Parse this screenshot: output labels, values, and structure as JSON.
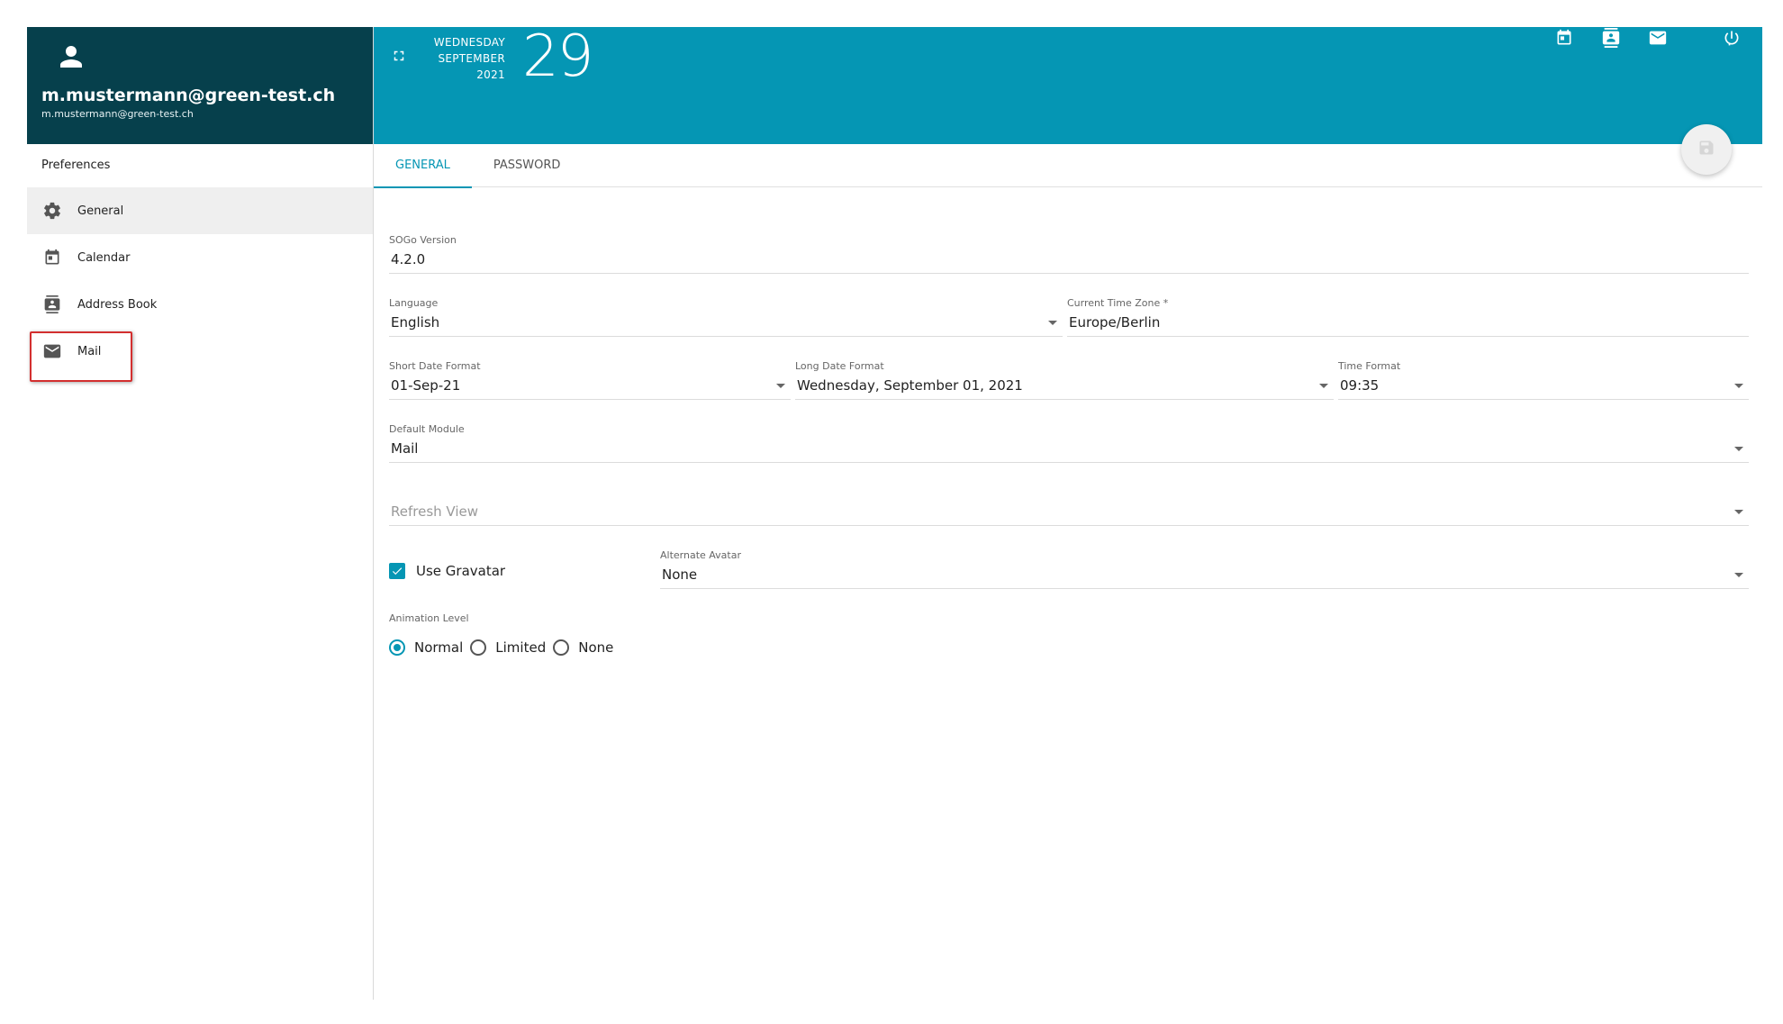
{
  "user": {
    "name": "m.mustermann@green-test.ch",
    "email": "m.mustermann@green-test.ch"
  },
  "sidebar": {
    "section_title": "Preferences",
    "items": [
      {
        "label": "General",
        "icon": "gear-icon"
      },
      {
        "label": "Calendar",
        "icon": "calendar-icon"
      },
      {
        "label": "Address Book",
        "icon": "contacts-icon"
      },
      {
        "label": "Mail",
        "icon": "mail-icon"
      }
    ]
  },
  "topbar": {
    "weekday": "WEDNESDAY",
    "month": "SEPTEMBER",
    "year": "2021",
    "day": "29",
    "icons": [
      "calendar-icon",
      "contacts-icon",
      "mail-icon",
      "power-icon"
    ]
  },
  "tabs": [
    {
      "label": "GENERAL"
    },
    {
      "label": "PASSWORD"
    }
  ],
  "form": {
    "sogo_version": {
      "label": "SOGo Version",
      "value": "4.2.0"
    },
    "language": {
      "label": "Language",
      "value": "English"
    },
    "timezone": {
      "label": "Current Time Zone *",
      "value": "Europe/Berlin"
    },
    "short_date": {
      "label": "Short Date Format",
      "value": "01-Sep-21"
    },
    "long_date": {
      "label": "Long Date Format",
      "value": "Wednesday, September 01, 2021"
    },
    "time_format": {
      "label": "Time Format",
      "value": "09:35"
    },
    "default_module": {
      "label": "Default Module",
      "value": "Mail"
    },
    "refresh_view": {
      "placeholder": "Refresh View"
    },
    "use_gravatar": {
      "label": "Use Gravatar",
      "checked": true
    },
    "alternate_avatar": {
      "label": "Alternate Avatar",
      "value": "None"
    },
    "animation_level": {
      "label": "Animation Level",
      "options": [
        "Normal",
        "Limited",
        "None"
      ],
      "selected": "Normal"
    }
  },
  "colors": {
    "accent": "#0596b4",
    "sidebar_header": "#06404c",
    "highlight": "#d32f2f"
  }
}
